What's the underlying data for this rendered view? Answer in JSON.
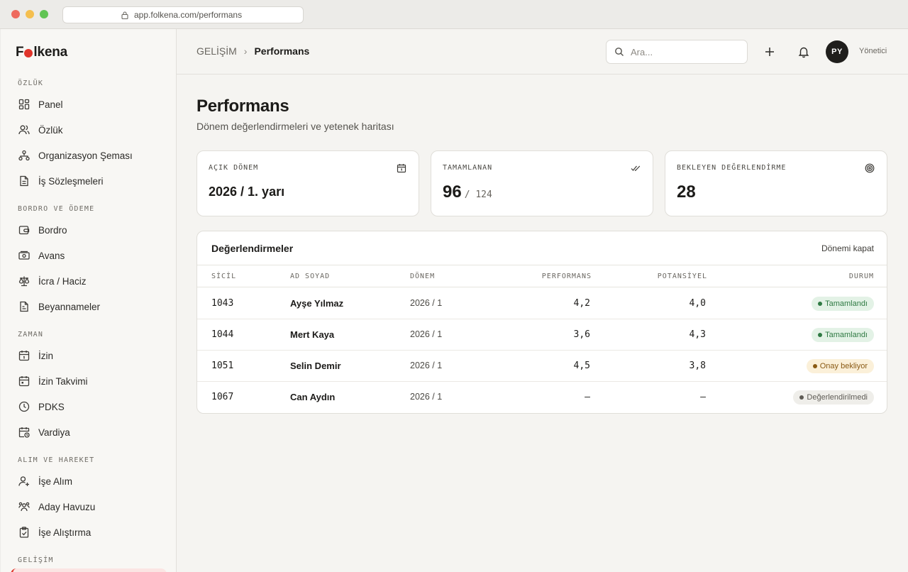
{
  "browser": {
    "url": "app.folkena.com/performans"
  },
  "app": {
    "logo_left": "F",
    "logo_right": "lkena"
  },
  "sidebar": {
    "sections": [
      {
        "label": "ÖZLÜK"
      },
      {
        "label": "BORDRO VE ÖDEME"
      },
      {
        "label": "ZAMAN"
      },
      {
        "label": "ALIM VE HAREKET"
      },
      {
        "label": "GELİŞİM"
      }
    ],
    "items": [
      {
        "label": "Panel",
        "icon": "grid-icon"
      },
      {
        "label": "Özlük",
        "icon": "users-icon"
      },
      {
        "label": "Organizasyon Şeması",
        "icon": "org-chart-icon"
      },
      {
        "label": "İş Sözleşmeleri",
        "icon": "document-icon"
      },
      {
        "label": "Bordro",
        "icon": "wallet-icon"
      },
      {
        "label": "Avans",
        "icon": "cash-icon"
      },
      {
        "label": "İcra / Haciz",
        "icon": "scale-icon"
      },
      {
        "label": "Beyannameler",
        "icon": "file-text-icon"
      },
      {
        "label": "İzin",
        "icon": "calendar-icon"
      },
      {
        "label": "İzin Takvimi",
        "icon": "calendar-grid-icon"
      },
      {
        "label": "PDKS",
        "icon": "clock-icon"
      },
      {
        "label": "Vardiya",
        "icon": "calendar-clock-icon"
      },
      {
        "label": "İşe Alım",
        "icon": "user-plus-icon"
      },
      {
        "label": "Aday Havuzu",
        "icon": "user-group-icon"
      },
      {
        "label": "İşe Alıştırma",
        "icon": "clipboard-check-icon"
      }
    ]
  },
  "header": {
    "breadcrumb_root": "GELİŞİM",
    "breadcrumb_sep": "›",
    "breadcrumb_current": "Performans",
    "search_placeholder": "Ara...",
    "avatar_initials": "PY",
    "user_role": "Yönetici"
  },
  "page": {
    "title": "Performans",
    "subtitle": "Dönem değerlendirmeleri ve yetenek haritası"
  },
  "stats": [
    {
      "label": "AÇIK DÖNEM",
      "value": "2026 / 1. yarı",
      "icon": "calendar-icon"
    },
    {
      "label": "TAMAMLANAN",
      "value": "96",
      "of": "/ 124",
      "icon": "double-check-icon"
    },
    {
      "label": "BEKLEYEN DEĞERLENDİRME",
      "value": "28",
      "icon": "target-icon"
    }
  ],
  "table": {
    "title": "Değerlendirmeler",
    "action": "Dönemi kapat",
    "columns": [
      "SİCİL",
      "AD SOYAD",
      "DÖNEM",
      "PERFORMANS",
      "POTANSİYEL",
      "DURUM"
    ],
    "rows": [
      {
        "id": "1043",
        "name": "Ayşe Yılmaz",
        "period": "2026 / 1",
        "performance": "4,2",
        "potential": "4,0",
        "status": "Tamamlandı",
        "status_type": "done"
      },
      {
        "id": "1044",
        "name": "Mert Kaya",
        "period": "2026 / 1",
        "performance": "3,6",
        "potential": "4,3",
        "status": "Tamamlandı",
        "status_type": "done"
      },
      {
        "id": "1051",
        "name": "Selin Demir",
        "period": "2026 / 1",
        "performance": "4,5",
        "potential": "3,8",
        "status": "Onay bekliyor",
        "status_type": "wait"
      },
      {
        "id": "1067",
        "name": "Can Aydın",
        "period": "2026 / 1",
        "performance": "—",
        "potential": "—",
        "status": "Değerlendirilmedi",
        "status_type": "none"
      }
    ]
  },
  "colors": {
    "accent": "#e0352b",
    "success": "#2f7a43",
    "warning": "#8a5a14"
  }
}
